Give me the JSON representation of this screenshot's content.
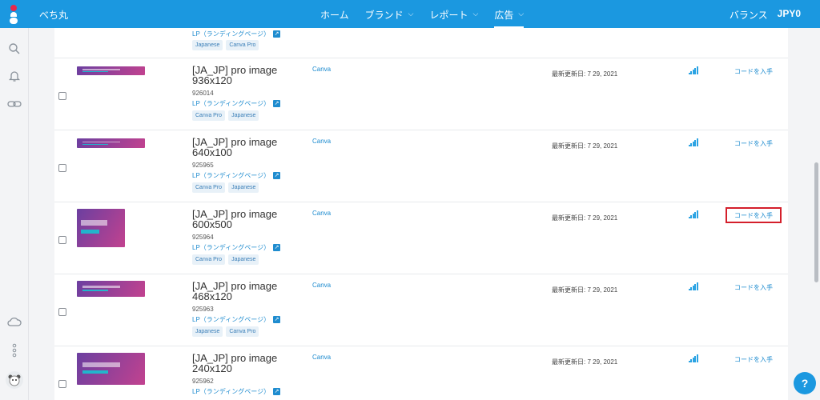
{
  "app": {
    "name": "べち丸"
  },
  "nav": [
    {
      "label": "ホーム",
      "dropdown": false,
      "active": false
    },
    {
      "label": "ブランド",
      "dropdown": true,
      "active": false
    },
    {
      "label": "レポート",
      "dropdown": true,
      "active": false
    },
    {
      "label": "広告",
      "dropdown": true,
      "active": true
    }
  ],
  "balance": {
    "label": "バランス",
    "value": "JPY0"
  },
  "sidebar": {
    "icons": [
      "search-icon",
      "bell-icon",
      "link-icon",
      "cloud-icon",
      "more-vertical-icon"
    ]
  },
  "partial_row": {
    "lp_label": "LP（ランディングページ）",
    "tags": [
      "Japanese",
      "Canva Pro"
    ]
  },
  "rows": [
    {
      "title": "[JA_JP] pro image 936x120",
      "id": "926014",
      "lp_label": "LP（ランディングページ）",
      "tags": [
        "Canva Pro",
        "Japanese"
      ],
      "platform": "Canva",
      "updated": "最新更新日: 7 29, 2021",
      "action": "コードを入手",
      "highlighted": false
    },
    {
      "title": "[JA_JP] pro image 640x100",
      "id": "925965",
      "lp_label": "LP（ランディングページ）",
      "tags": [
        "Canva Pro",
        "Japanese"
      ],
      "platform": "Canva",
      "updated": "最新更新日: 7 29, 2021",
      "action": "コードを入手",
      "highlighted": false
    },
    {
      "title": "[JA_JP] pro image 600x500",
      "id": "925964",
      "lp_label": "LP（ランディングページ）",
      "tags": [
        "Canva Pro",
        "Japanese"
      ],
      "platform": "Canva",
      "updated": "最新更新日: 7 29, 2021",
      "action": "コードを入手",
      "highlighted": true
    },
    {
      "title": "[JA_JP] pro image 468x120",
      "id": "925963",
      "lp_label": "LP（ランディングページ）",
      "tags": [
        "Japanese",
        "Canva Pro"
      ],
      "platform": "Canva",
      "updated": "最新更新日: 7 29, 2021",
      "action": "コードを入手",
      "highlighted": false
    },
    {
      "title": "[JA_JP] pro image 240x120",
      "id": "925962",
      "lp_label": "LP（ランディングページ）",
      "tags": [],
      "platform": "Canva",
      "updated": "最新更新日: 7 29, 2021",
      "action": "コードを入手",
      "highlighted": false
    }
  ],
  "help": {
    "label": "?"
  },
  "colors": {
    "accent": "#1b98e0",
    "highlight": "#d41f2b",
    "thumb_purple": "#6b3fa0",
    "thumb_pink": "#c2428f"
  }
}
